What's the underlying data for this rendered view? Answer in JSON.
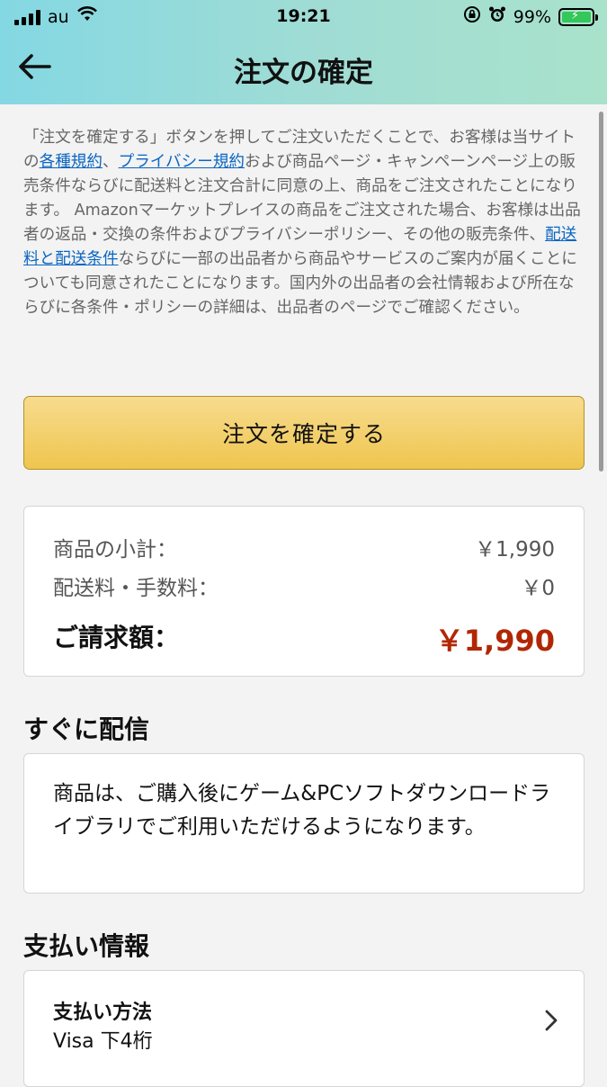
{
  "status_bar": {
    "carrier": "au",
    "time": "19:21",
    "battery": "99%"
  },
  "header": {
    "title": "注文の確定",
    "back_icon": "back-arrow-icon"
  },
  "legal": {
    "t1": "「注文を確定する」ボタンを押してご注文いただくことで、お客様は当サイトの",
    "link_terms": "各種規約",
    "t2": "、",
    "link_privacy": "プライバシー規約",
    "t3": "および商品ページ・キャンペーンページ上の販売条件ならびに配送料と注文合計に同意の上、商品をご注文されたことになります。 Amazonマーケットプレイスの商品をご注文された場合、お客様は出品者の返品・交換の条件およびプライバシーポリシー、その他の販売条件、",
    "link_shipping": "配送料と配送条件",
    "t4": "ならびに一部の出品者から商品やサービスのご案内が届くことについても同意されたことになります。国内外の出品者の会社情報および所在ならびに各条件・ポリシーの詳細は、出品者のページでご確認ください。"
  },
  "confirm_button": "注文を確定する",
  "summary": {
    "subtotal_label": "商品の小計：",
    "subtotal_value": "￥1,990",
    "shipping_label": "配送料・手数料：",
    "shipping_value": "￥0",
    "total_label": "ご請求額：",
    "total_value": "￥1,990"
  },
  "delivery": {
    "title": "すぐに配信",
    "text": "商品は、ご購入後にゲーム&PCソフトダウンロードライブラリでご利用いただけるようになります。"
  },
  "payment": {
    "title": "支払い情報",
    "method_label": "支払い方法",
    "card_text": "Visa 下4桁"
  },
  "colors": {
    "header_gradient_start": "#84d8e3",
    "header_gradient_end": "#a9e2cb",
    "button": "#f0c14b",
    "total_price": "#b12704",
    "link": "#0a66c2"
  }
}
